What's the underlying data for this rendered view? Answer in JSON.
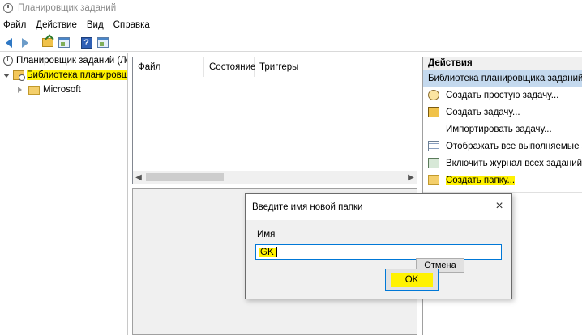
{
  "window": {
    "title": "Планировщик заданий"
  },
  "menu": [
    "Файл",
    "Действие",
    "Вид",
    "Справка"
  ],
  "toolbar": {
    "icons": [
      "back-arrow-icon",
      "forward-arrow-icon",
      "folder-up-icon",
      "show-hide-console-tree-icon",
      "help-icon",
      "show-hide-action-pane-icon"
    ]
  },
  "tree": {
    "root": "Планировщик заданий (Лок",
    "library": "Библиотека планировщ",
    "child": "Microsoft"
  },
  "list": {
    "columns": [
      "Файл",
      "Состояние",
      "Триггеры"
    ]
  },
  "actions": {
    "header": "Действия",
    "section": "Библиотека планировщика заданий",
    "items": [
      {
        "label": "Создать простую задачу...",
        "icon": "create-basic-task-icon"
      },
      {
        "label": "Создать задачу...",
        "icon": "create-task-icon"
      },
      {
        "label": "Импортировать задачу...",
        "icon": ""
      },
      {
        "label": "Отображать все выполняемые зада",
        "icon": "running-tasks-icon"
      },
      {
        "label": "Включить журнал всех заданий",
        "icon": "task-history-icon"
      },
      {
        "label": "Создать папку...",
        "icon": "new-folder-icon",
        "highlighted": true
      }
    ]
  },
  "dialog": {
    "title": "Введите имя новой папки",
    "close": "×",
    "name_label": "Имя",
    "input_value": "GK",
    "cancel": "Отмена",
    "ok": "OK"
  },
  "colors": {
    "highlight": "#fff200",
    "selection": "#c4d9ee",
    "focus": "#0078d7"
  }
}
